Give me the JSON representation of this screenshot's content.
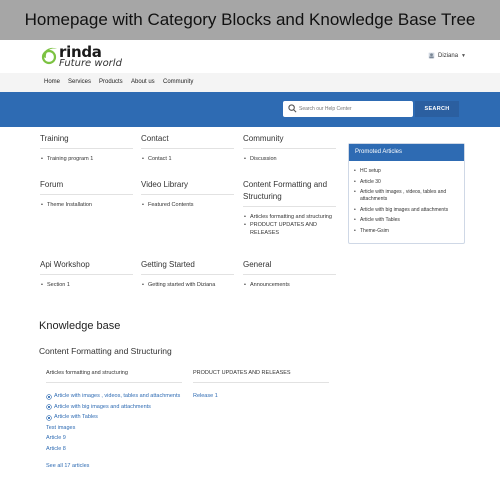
{
  "caption": "Homepage with Category Blocks and Knowledge Base Tree",
  "header": {
    "brand": "rinda",
    "tagline": "Future world",
    "user_name": "Diziana"
  },
  "nav": [
    "Home",
    "Services",
    "Products",
    "About us",
    "Community"
  ],
  "search": {
    "placeholder": "Search our Help Center",
    "button_label": "SEARCH"
  },
  "categories": [
    {
      "title": "Training",
      "items": [
        "Training program 1"
      ]
    },
    {
      "title": "Contact",
      "items": [
        "Contact 1"
      ]
    },
    {
      "title": "Community",
      "items": [
        "Discussion"
      ]
    },
    {
      "title": "Forum",
      "items": [
        "Theme Installation"
      ]
    },
    {
      "title": "Video Library",
      "items": [
        "Featured Contents"
      ]
    },
    {
      "title": "Content Formatting and Structuring",
      "items": [
        "Articles formatting and structuring",
        "PRODUCT UPDATES AND RELEASES"
      ]
    },
    {
      "title": "Api Workshop",
      "items": [
        "Section 1"
      ]
    },
    {
      "title": "Getting Started",
      "items": [
        "Getting started with Diziana"
      ]
    },
    {
      "title": "General",
      "items": [
        "Announcements"
      ]
    }
  ],
  "promoted": {
    "title": "Promoted Articles",
    "items": [
      "HC setup",
      "Article 30",
      "Article with images , videos, tables and attachments",
      "Article with big images and attachments",
      "Article with Tables",
      "Theme-Gsim"
    ]
  },
  "knowledge_base": {
    "title": "Knowledge base",
    "subtitle": "Content Formatting and Structuring",
    "sections": [
      {
        "title": "Articles formatting and structuring",
        "links": [
          {
            "text": "Article with images , videos, tables and attachments",
            "promoted": true
          },
          {
            "text": "Article with big images and attachments",
            "promoted": true
          },
          {
            "text": "Article with Tables",
            "promoted": true
          },
          {
            "text": "Test images",
            "promoted": false
          },
          {
            "text": "Article 9",
            "promoted": false
          },
          {
            "text": "Article 8",
            "promoted": false
          }
        ],
        "see_all": "See all 17 articles"
      },
      {
        "title": "PRODUCT UPDATES AND RELEASES",
        "links": [
          {
            "text": "Release 1",
            "promoted": false
          }
        ]
      }
    ]
  },
  "colors": {
    "accent": "#2e6bb3",
    "logo_green": "#7cc242",
    "caption_bg": "#a6a6a6"
  },
  "icons": {
    "search": "search-icon",
    "user": "user-icon",
    "promoted": "promoted-circle-icon"
  }
}
